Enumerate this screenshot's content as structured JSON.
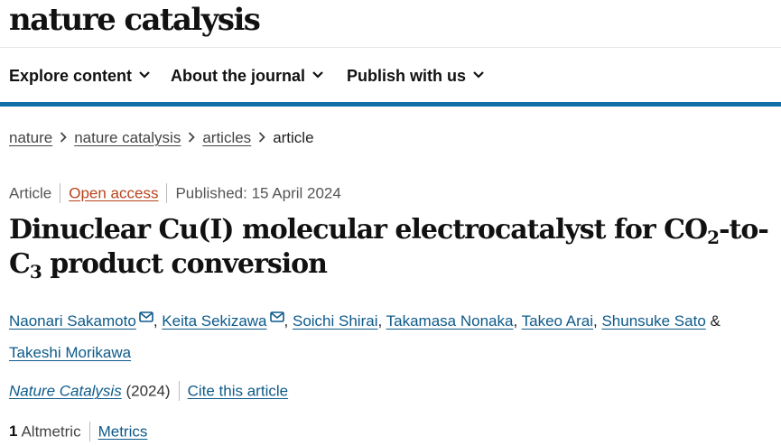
{
  "site": {
    "logo": "nature catalysis"
  },
  "nav": {
    "explore": "Explore content",
    "about": "About the journal",
    "publish": "Publish with us"
  },
  "breadcrumb": [
    "nature",
    "nature catalysis",
    "articles",
    "article"
  ],
  "meta": {
    "type": "Article",
    "access": "Open access",
    "published": "Published: 15 April 2024"
  },
  "title": {
    "part1": "Dinuclear Cu(I) molecular electrocatalyst for CO",
    "sub1": "2",
    "part2": "-to-C",
    "sub2": "3",
    "part3": " product conversion"
  },
  "authors": [
    {
      "name": "Naonari Sakamoto",
      "mail": true
    },
    {
      "name": "Keita Sekizawa",
      "mail": true
    },
    {
      "name": "Soichi Shirai"
    },
    {
      "name": "Takamasa Nonaka"
    },
    {
      "name": "Takeo Arai"
    },
    {
      "name": "Shunsuke Sato"
    },
    {
      "name": "Takeshi Morikawa"
    }
  ],
  "authors_sep": {
    "comma": ",",
    "and": "&"
  },
  "citation": {
    "journal": "Nature Catalysis",
    "year": "(2024)",
    "cite": "Cite this article"
  },
  "metrics": {
    "count": "1",
    "altmetric": "Altmetric",
    "link": "Metrics"
  },
  "colors": {
    "accent_rule": "#0f6fa8",
    "link": "#0d5a8a",
    "open_access": "#b8431c"
  },
  "icons": {
    "nav_chevron": "chevron-down-icon",
    "author_mail": "envelope-icon",
    "breadcrumb_sep": "chevron-right-icon"
  }
}
